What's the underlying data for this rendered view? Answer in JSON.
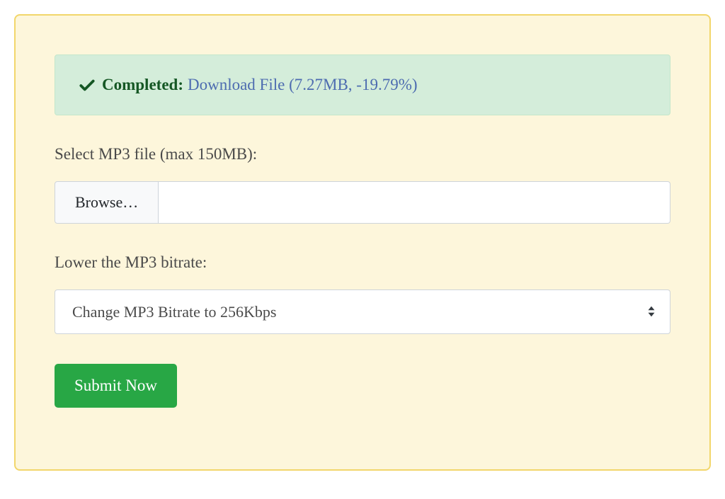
{
  "alert": {
    "status_label": "Completed:",
    "download_text": "Download File (7.27MB, -19.79%)"
  },
  "file": {
    "label": "Select MP3 file (max 150MB):",
    "browse_label": "Browse…"
  },
  "bitrate": {
    "label": "Lower the MP3 bitrate:",
    "selected": "Change MP3 Bitrate to 256Kbps"
  },
  "submit": {
    "label": "Submit Now"
  }
}
